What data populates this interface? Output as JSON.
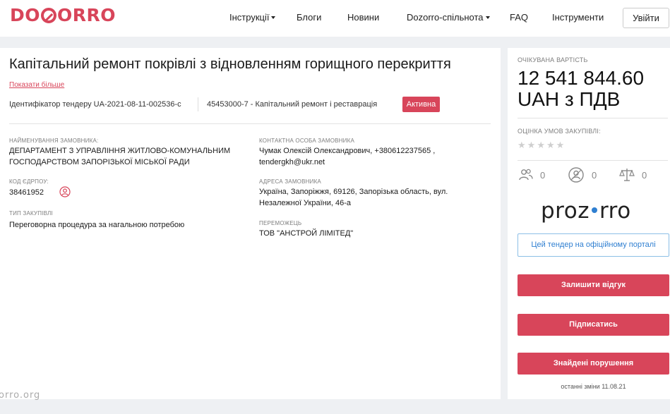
{
  "header": {
    "logo": "DOZORRO",
    "nav": [
      {
        "label": "Інструкції",
        "dropdown": true
      },
      {
        "label": "Блоги",
        "dropdown": false
      },
      {
        "label": "Новини",
        "dropdown": false
      },
      {
        "label": "Dozorro-спільнота",
        "dropdown": true
      },
      {
        "label": "FAQ",
        "dropdown": false
      },
      {
        "label": "Інструменти",
        "dropdown": false
      }
    ],
    "login_label": "Увійти"
  },
  "tender": {
    "title": "Капітальний ремонт покрівлі з відновленням горищного перекриття",
    "show_more": "Показати більше",
    "identifier": "Ідентифікатор тендеру UA-2021-08-11-002536-c",
    "cpv": "45453000-7 - Капітальний ремонт і реставрація",
    "status": "Активна"
  },
  "details": {
    "customer_name_label": "НАЙМЕНУВАННЯ ЗАМОВНИКА:",
    "customer_name_line1": "ДЕПАРТАМЕНТ З УПРАВЛІННЯ ЖИТЛОВО-КОМУНАЛЬНИМ",
    "customer_name_line2": "ГОСПОДАРСТВОМ ЗАПОРІЗЬКОЇ МІСЬКОЇ РАДИ",
    "edrpou_label": "КОД ЄДРПОУ:",
    "edrpou": "38461952",
    "procurement_type_label": "ТИП ЗАКУПІВЛІ",
    "procurement_type": "Переговорна процедура за нагальною потребою",
    "contact_label": "КОНТАКТНА ОСОБА ЗАМОВНИКА",
    "contact_line1": "Чумак Олексій Олександрович, +380612237565 ,",
    "contact_line2": "tendergkh@ukr.net",
    "address_label": "АДРЕСА ЗАМОВНИКА",
    "address_line1": "Україна, Запоріжжя, 69126, Запорізька область, вул.",
    "address_line2": "Незалежної України, 46-а",
    "winner_label": "ПЕРЕМОЖЕЦЬ",
    "winner": "ТОВ \"АНСТРОЙ ЛІМІТЕД\""
  },
  "sidebar": {
    "expected_cost_label": "ОЧІКУВАНА ВАРТІСТЬ",
    "amount_line1": "12 541 844.60",
    "amount_line2": "UAH з ПДВ",
    "conditions_label": "ОЦІНКА УМОВ ЗАКУПІВЛІ:",
    "rating_stars": 0,
    "rating_max": 5,
    "stats": [
      {
        "icon": "users-icon",
        "value": "0"
      },
      {
        "icon": "monitor-user-icon",
        "value": "0"
      },
      {
        "icon": "scales-icon",
        "value": "0"
      }
    ],
    "prozorro_logo": "prozorro",
    "portal_button": "Цей тендер на офіційному порталі",
    "feedback_button": "Залишити відгук",
    "subscribe_button": "Підписатись",
    "violations_button": "Знайдені порушення",
    "last_change": "останні зміни 11.08.21",
    "accent_color": "#d8455a",
    "link_color": "#2f7fd1"
  },
  "watermark": "orro.org"
}
